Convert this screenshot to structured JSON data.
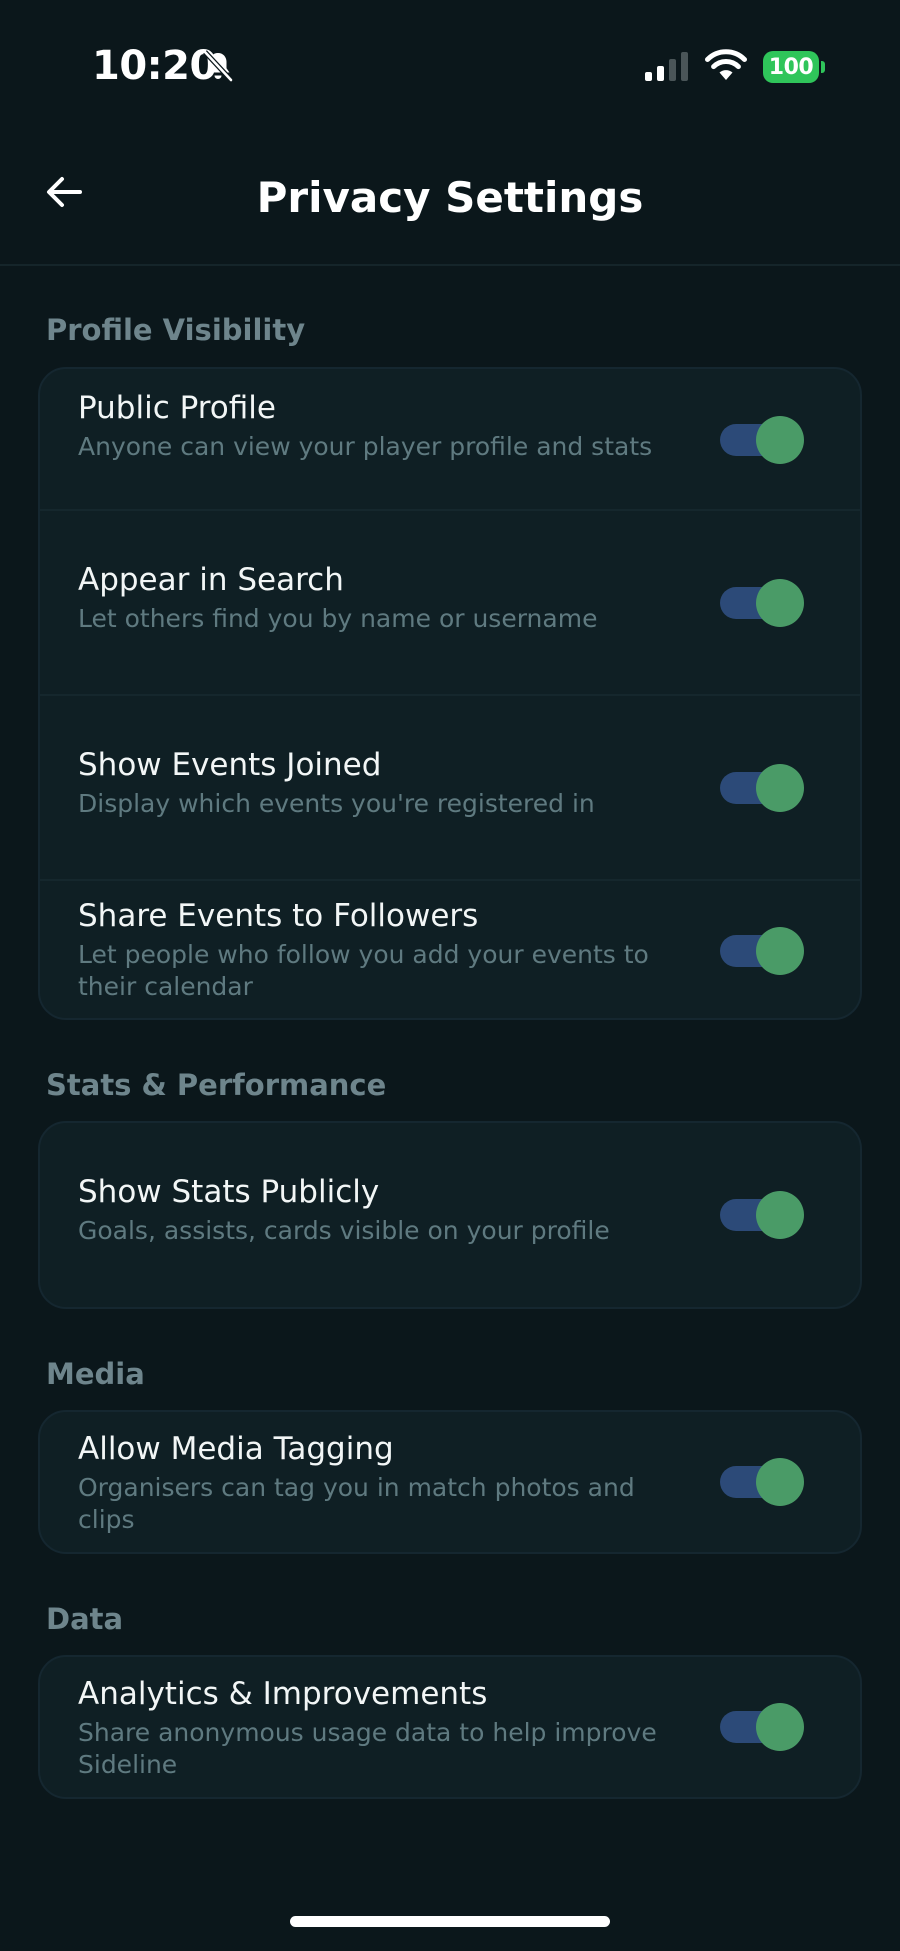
{
  "status_bar": {
    "time": "10:20",
    "battery": "100",
    "icons": [
      "bell-slash-icon",
      "cellular-signal-icon",
      "wifi-icon",
      "battery-icon"
    ]
  },
  "header": {
    "title": "Privacy Settings",
    "back_icon": "arrow-left-icon"
  },
  "sections": [
    {
      "label": "Profile Visibility",
      "items": [
        {
          "title": "Public Profile",
          "description": "Anyone can view your player profile and stats",
          "enabled": true
        },
        {
          "title": "Appear in Search",
          "description": "Let others find you by name or username",
          "enabled": true
        },
        {
          "title": "Show Events Joined",
          "description": "Display which events you're registered in",
          "enabled": true
        },
        {
          "title": "Share Events to Followers",
          "description": "Let people who follow you add your events to their calendar",
          "enabled": true
        }
      ]
    },
    {
      "label": "Stats & Performance",
      "items": [
        {
          "title": "Show Stats Publicly",
          "description": "Goals, assists, cards visible on your profile",
          "enabled": true
        }
      ]
    },
    {
      "label": "Media",
      "items": [
        {
          "title": "Allow Media Tagging",
          "description": "Organisers can tag you in match photos and clips",
          "enabled": true
        }
      ]
    },
    {
      "label": "Data",
      "items": [
        {
          "title": "Analytics & Improvements",
          "description": "Share anonymous usage data to help improve Sideline",
          "enabled": true
        }
      ]
    }
  ],
  "colors": {
    "background": "#0b171b",
    "card": "#0f1f24",
    "toggle_track": "#2c4a78",
    "toggle_knob": "#4a9b67",
    "battery": "#2fc55a",
    "section_label": "#6e858c",
    "description": "#5f7a80"
  }
}
